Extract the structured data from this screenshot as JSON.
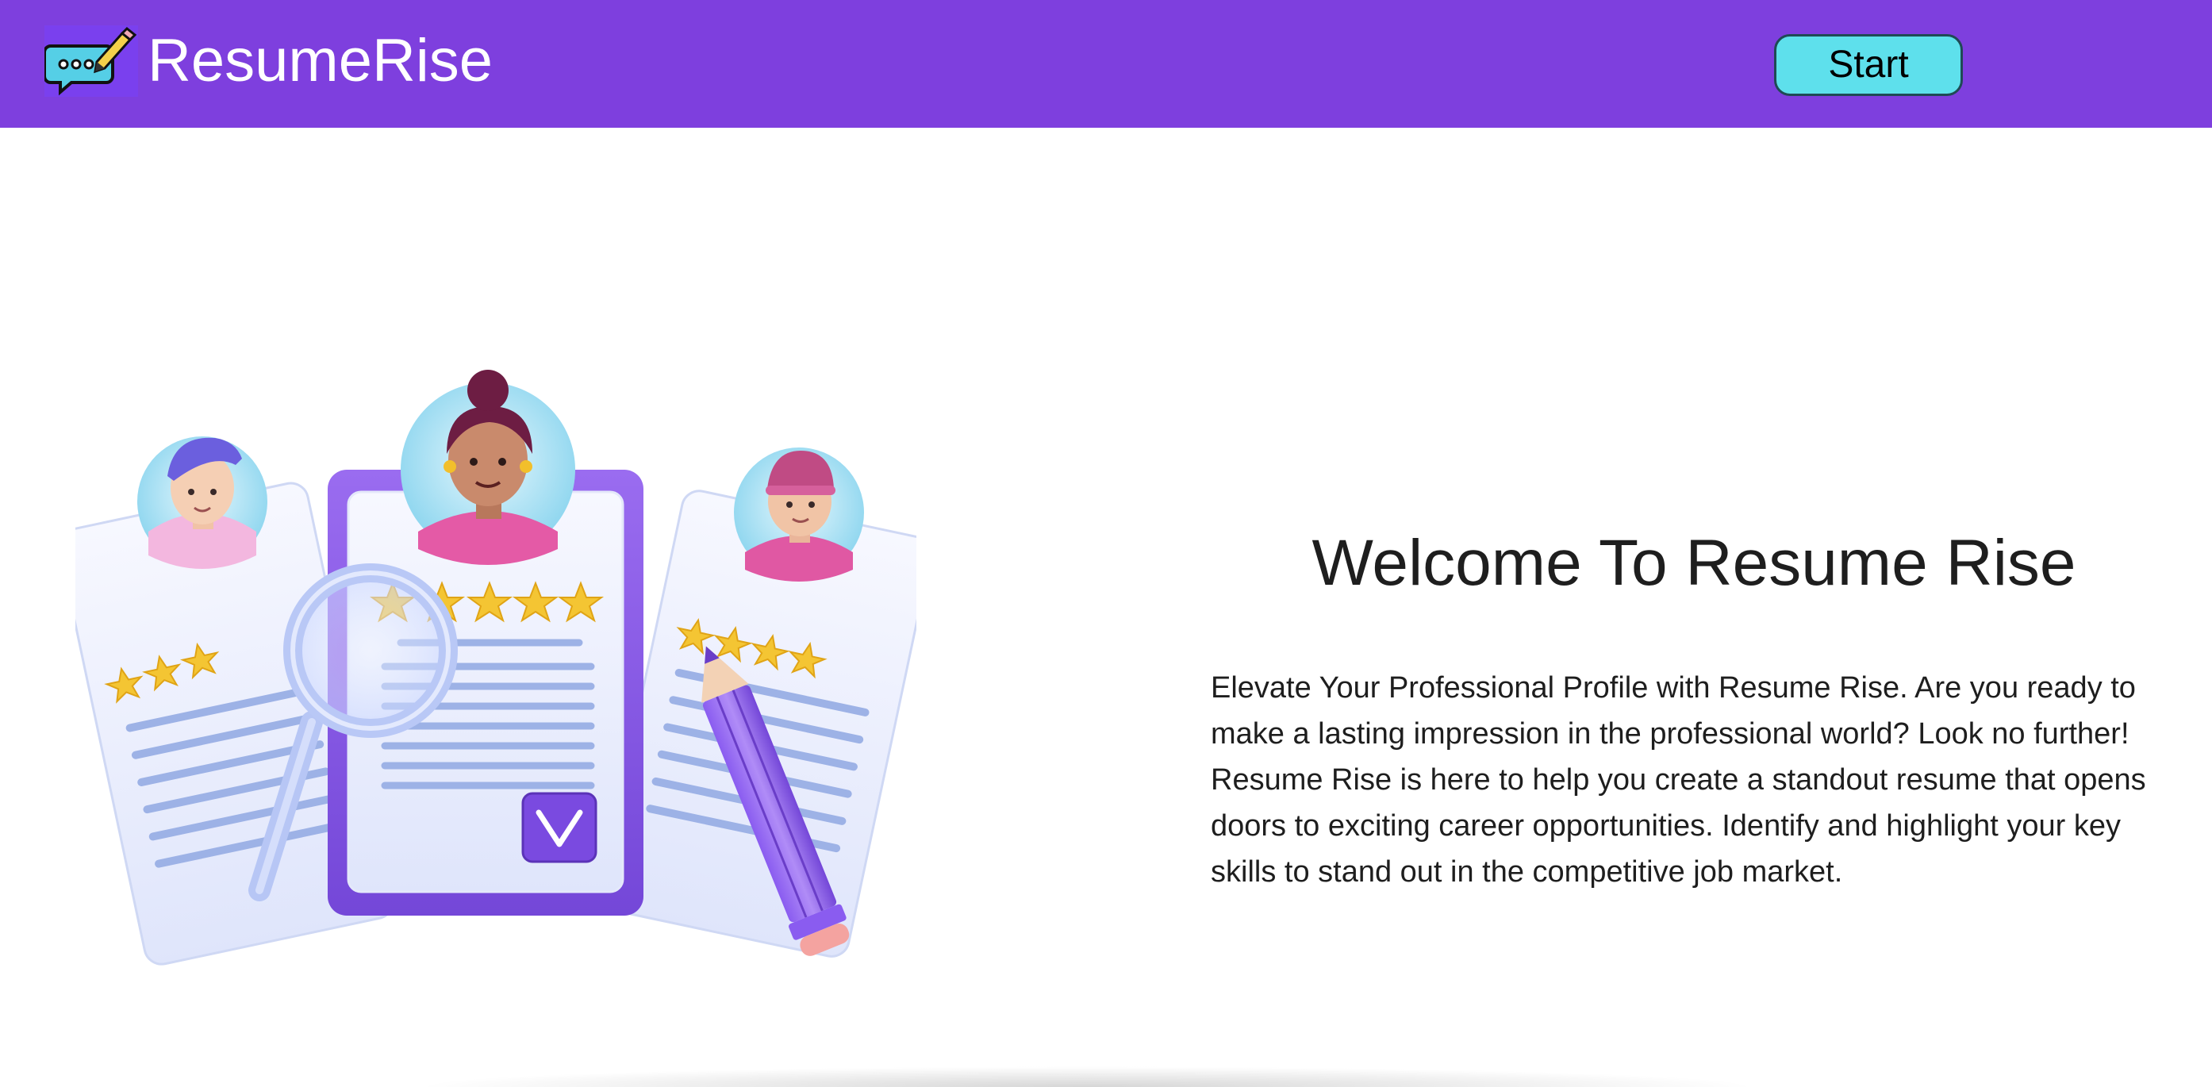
{
  "header": {
    "brand_name": "ResumeRise",
    "logo_icon": "chat-bubble-pencil-icon",
    "start_label": "Start",
    "colors": {
      "background": "#7e3fde",
      "start_button": "#5ee0ec",
      "brand_text": "#ffffff"
    }
  },
  "hero": {
    "illustration": "resume-review-illustration",
    "title": "Welcome To Resume Rise",
    "description": "Elevate Your Professional Profile with Resume Rise. Are you ready to make a lasting impression in the professional world? Look no further! Resume Rise is here to help you create a standout resume that opens doors to exciting career opportunities. Identify and highlight your key skills to stand out in the competitive job market."
  }
}
